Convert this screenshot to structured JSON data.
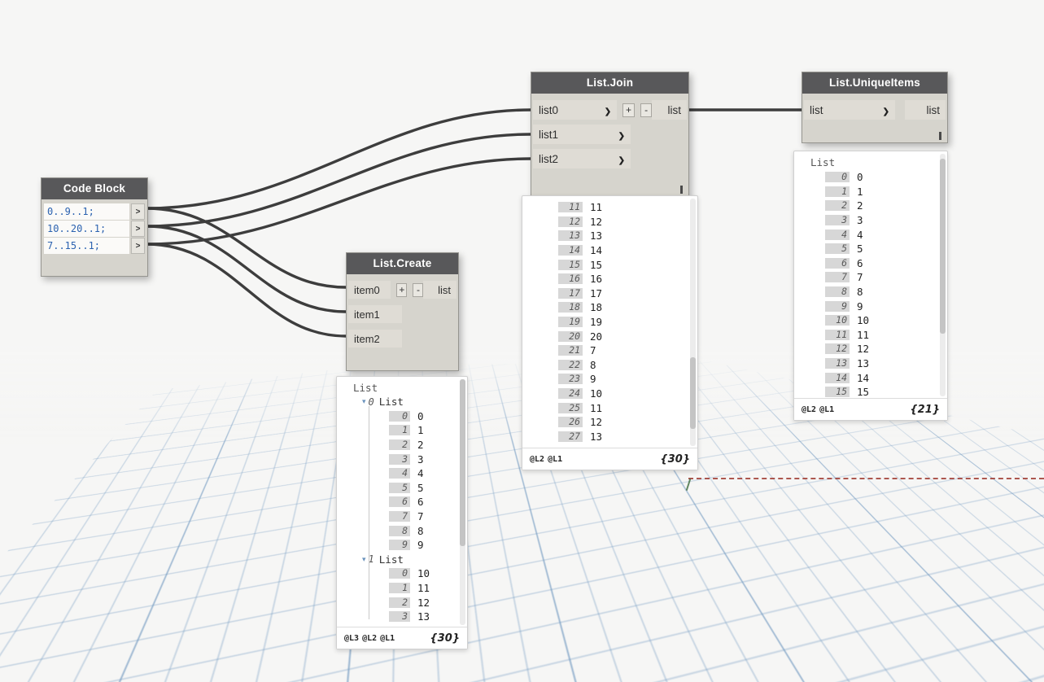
{
  "nodes": {
    "code_block": {
      "title": "Code Block",
      "lines": [
        "0..9..1;",
        "10..20..1;",
        "7..15..1;"
      ]
    },
    "list_create": {
      "title": "List.Create",
      "inputs": [
        "item0",
        "item1",
        "item2"
      ],
      "add": "+",
      "remove": "-",
      "output": "list"
    },
    "list_join": {
      "title": "List.Join",
      "inputs": [
        "list0",
        "list1",
        "list2"
      ],
      "add": "+",
      "remove": "-",
      "output": "list"
    },
    "list_unique": {
      "title": "List.UniqueItems",
      "input": "list",
      "output": "list"
    }
  },
  "previews": {
    "create": {
      "header": "List",
      "groups": [
        {
          "index": "0",
          "label": "List",
          "items": [
            {
              "i": "0",
              "v": "0"
            },
            {
              "i": "1",
              "v": "1"
            },
            {
              "i": "2",
              "v": "2"
            },
            {
              "i": "3",
              "v": "3"
            },
            {
              "i": "4",
              "v": "4"
            },
            {
              "i": "5",
              "v": "5"
            },
            {
              "i": "6",
              "v": "6"
            },
            {
              "i": "7",
              "v": "7"
            },
            {
              "i": "8",
              "v": "8"
            },
            {
              "i": "9",
              "v": "9"
            }
          ]
        },
        {
          "index": "1",
          "label": "List",
          "items": [
            {
              "i": "0",
              "v": "10"
            },
            {
              "i": "1",
              "v": "11"
            },
            {
              "i": "2",
              "v": "12"
            },
            {
              "i": "3",
              "v": "13"
            }
          ]
        }
      ],
      "levels": [
        "@L3",
        "@L2",
        "@L1"
      ],
      "count": "{30}"
    },
    "join": {
      "items": [
        {
          "i": "11",
          "v": "11"
        },
        {
          "i": "12",
          "v": "12"
        },
        {
          "i": "13",
          "v": "13"
        },
        {
          "i": "14",
          "v": "14"
        },
        {
          "i": "15",
          "v": "15"
        },
        {
          "i": "16",
          "v": "16"
        },
        {
          "i": "17",
          "v": "17"
        },
        {
          "i": "18",
          "v": "18"
        },
        {
          "i": "19",
          "v": "19"
        },
        {
          "i": "20",
          "v": "20"
        },
        {
          "i": "21",
          "v": "7"
        },
        {
          "i": "22",
          "v": "8"
        },
        {
          "i": "23",
          "v": "9"
        },
        {
          "i": "24",
          "v": "10"
        },
        {
          "i": "25",
          "v": "11"
        },
        {
          "i": "26",
          "v": "12"
        },
        {
          "i": "27",
          "v": "13"
        }
      ],
      "levels": [
        "@L2",
        "@L1"
      ],
      "count": "{30}"
    },
    "unique": {
      "header": "List",
      "items": [
        {
          "i": "0",
          "v": "0"
        },
        {
          "i": "1",
          "v": "1"
        },
        {
          "i": "2",
          "v": "2"
        },
        {
          "i": "3",
          "v": "3"
        },
        {
          "i": "4",
          "v": "4"
        },
        {
          "i": "5",
          "v": "5"
        },
        {
          "i": "6",
          "v": "6"
        },
        {
          "i": "7",
          "v": "7"
        },
        {
          "i": "8",
          "v": "8"
        },
        {
          "i": "9",
          "v": "9"
        },
        {
          "i": "10",
          "v": "10"
        },
        {
          "i": "11",
          "v": "11"
        },
        {
          "i": "12",
          "v": "12"
        },
        {
          "i": "13",
          "v": "13"
        },
        {
          "i": "14",
          "v": "14"
        },
        {
          "i": "15",
          "v": "15"
        }
      ],
      "levels": [
        "@L2",
        "@L1"
      ],
      "count": "{21}"
    }
  },
  "colors": {
    "node_title_bg": "#58585a",
    "node_body_bg": "#d6d4cd",
    "port_chip_bg": "#dfdcd5",
    "code_text": "#2b62b0",
    "grid_line": "#789ec4",
    "axis_red": "#a03b32",
    "wire": "#3d3d3d"
  }
}
